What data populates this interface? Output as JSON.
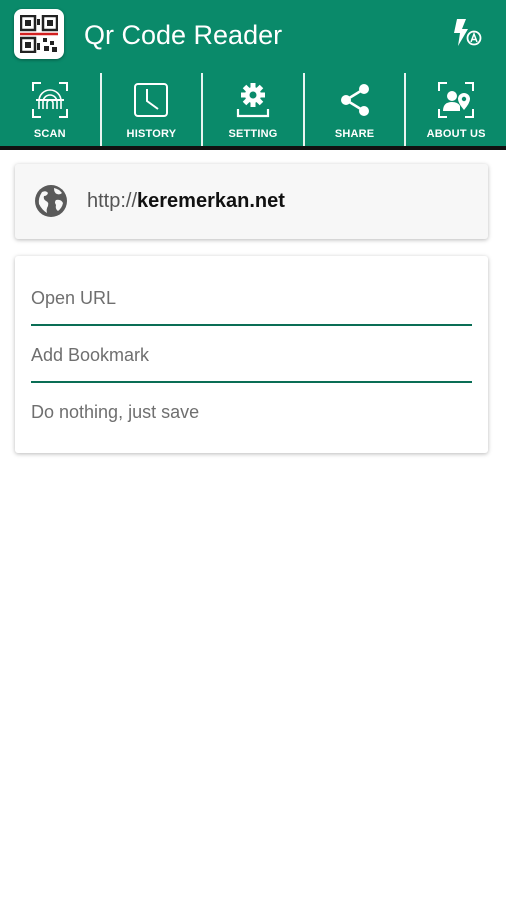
{
  "app": {
    "title": "Qr Code Reader",
    "accent_color": "#0a8a6a",
    "icon": "qr-code-app-icon"
  },
  "header": {
    "flash_icon": "flash-auto-icon"
  },
  "tabs": [
    {
      "label": "SCAN",
      "icon": "scan-icon"
    },
    {
      "label": "HISTORY",
      "icon": "history-icon"
    },
    {
      "label": "SETTING",
      "icon": "setting-icon"
    },
    {
      "label": "SHARE",
      "icon": "share-icon"
    },
    {
      "label": "ABOUT US",
      "icon": "about-us-icon"
    }
  ],
  "result": {
    "icon": "globe-icon",
    "url_prefix": "http://",
    "url_domain": "keremerkan.net"
  },
  "options": [
    {
      "label": "Open URL"
    },
    {
      "label": "Add Bookmark"
    },
    {
      "label": "Do nothing, just save"
    }
  ]
}
